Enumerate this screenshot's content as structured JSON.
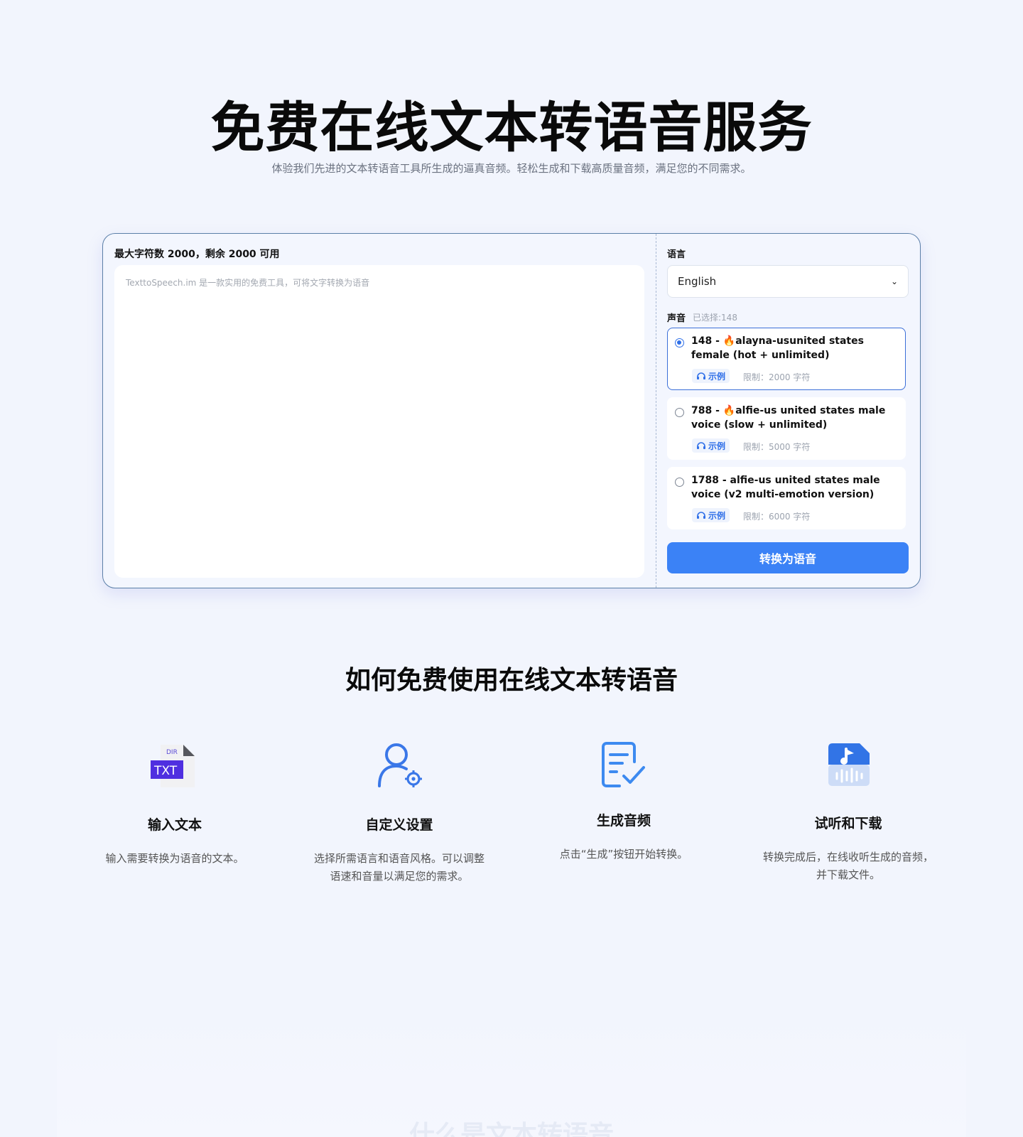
{
  "hero": {
    "title": "免费在线文本转语音服务",
    "subtitle": "体验我们先进的文本转语音工具所生成的逼真音频。轻松生成和下载高质量音频，满足您的不同需求。"
  },
  "editor": {
    "char_count": "最大字符数 2000，剩余 2000 可用",
    "placeholder": "TexttoSpeech.im 是一款实用的免费工具，可将文字转换为语音"
  },
  "language": {
    "label": "语言",
    "selected": "English"
  },
  "voice": {
    "label": "声音",
    "selected_text": "已选择:148",
    "items": [
      {
        "name": "148 - 🔥alayna-usunited states female (hot + unlimited)",
        "sample": "示例",
        "limit": "限制：2000 字符",
        "selected": true
      },
      {
        "name": "788 - 🔥alfie-us united states male voice (slow + unlimited)",
        "sample": "示例",
        "limit": "限制：5000 字符",
        "selected": false
      },
      {
        "name": "1788 - alfie-us united states male voice (v2 multi-emotion version)",
        "sample": "示例",
        "limit": "限制：6000 字符",
        "selected": false
      }
    ]
  },
  "convert_button": "转换为语音",
  "how_to": {
    "title": "如何免费使用在线文本转语音",
    "steps": [
      {
        "icon": "txt-file-icon",
        "title": "输入文本",
        "desc": "输入需要转换为语音的文本。"
      },
      {
        "icon": "user-settings-icon",
        "title": "自定义设置",
        "desc": "选择所需语言和语音风格。可以调整语速和音量以满足您的需求。"
      },
      {
        "icon": "document-check-icon",
        "title": "生成音频",
        "desc": "点击“生成”按钮开始转换。"
      },
      {
        "icon": "audio-file-icon",
        "title": "试听和下载",
        "desc": "转换完成后，在线收听生成的音频，并下载文件。"
      }
    ]
  },
  "next_section_title": "什么是文本转语音",
  "colors": {
    "accent": "#3b82f6",
    "background": "#f2f5fd",
    "card_border": "#5b7fa8"
  }
}
